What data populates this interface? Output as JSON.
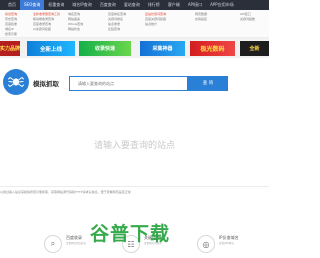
{
  "nav": {
    "items": [
      "首页",
      "SEO查询",
      "权重查询",
      "域名IP查询",
      "百度查询",
      "爱站查询",
      "排行榜",
      "客户端",
      "API接口",
      "APP应用市场"
    ],
    "active_index": 1
  },
  "links": {
    "col1": [
      "综合查询",
      "历史查询",
      "百度权重",
      "域名IP",
      "搜索引擎",
      "SEO数据"
    ],
    "col2": [
      "全新收录量查询工具",
      "移动端收录查询",
      "百度收录查询",
      "AI关键词挖掘"
    ],
    "col3": [
      "域名查询",
      "网站备案",
      "Whois查询",
      "网站状态"
    ],
    "col4": [
      "百度排名查询",
      "关键词排名",
      "站点收录",
      "反链查询"
    ],
    "col5": [
      "爱站长尾词查询",
      "百度关键词挖掘",
      "站点统计"
    ],
    "col6": [
      "网页数据",
      "友情链接"
    ],
    "col7": [
      "API接口",
      "关键词指数"
    ]
  },
  "banners": [
    "实力品牌",
    "全新上线",
    "收录快速",
    "采集神器",
    "极光数码",
    "全新"
  ],
  "tool": {
    "title": "模拟抓取",
    "search_placeholder": "请输入要查询的站点",
    "search_button": "查 询",
    "empty_prompt": "请输入要查询的站点"
  },
  "footer": {
    "note": "以通过输入站点来模拟搜索引擎抓取，获取网站源代码和HTTP请求头信息，便于查看网页是否正常",
    "features": [
      {
        "title": "百度收录",
        "sub": "查看网站百度收录"
      },
      {
        "title": "关键词查询",
        "sub": "查看网站关键词"
      },
      {
        "title": "IP反查域名",
        "sub": "查看同IP网站"
      }
    ]
  },
  "watermark": "谷普下载",
  "colors": {
    "accent": "#2a7fd6",
    "nav_bg": "#2b2f3a",
    "watermark": "#26a33d"
  }
}
